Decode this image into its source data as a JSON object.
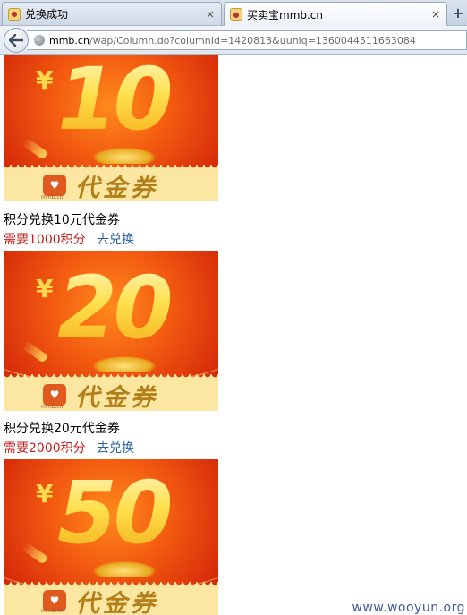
{
  "browser": {
    "tabs": [
      {
        "title": "兑换成功",
        "active": false
      },
      {
        "title": "买卖宝mmb.cn",
        "active": true
      }
    ],
    "new_tab_label": "+",
    "close_label": "×",
    "url_domain": "mmb.cn",
    "url_path": "/wap/Column.do?columnId=1420813&uuniq=1360044511663084"
  },
  "coupons": [
    {
      "image_yen": "¥",
      "image_amount": "10",
      "image_text": "代金券",
      "image_logo_text": "mmb.cn",
      "title": "积分兑换10元代金券",
      "cost": "需要1000积分",
      "link": "去兑换"
    },
    {
      "image_yen": "¥",
      "image_amount": "20",
      "image_text": "代金券",
      "image_logo_text": "mmb.cn",
      "title": "积分兑换20元代金券",
      "cost": "需要2000积分",
      "link": "去兑换"
    },
    {
      "image_yen": "¥",
      "image_amount": "50",
      "image_text": "代金券",
      "image_logo_text": "mmb.cn",
      "title": "",
      "cost": "",
      "link": ""
    }
  ],
  "watermark": "www.wooyun.org",
  "colors": {
    "cost_text": "#cc1b1b",
    "link_text": "#2a5ea2",
    "coupon_red": "#d72c0a",
    "coupon_gold": "#ffe04e",
    "ticket_bg": "#fbe7a1"
  }
}
